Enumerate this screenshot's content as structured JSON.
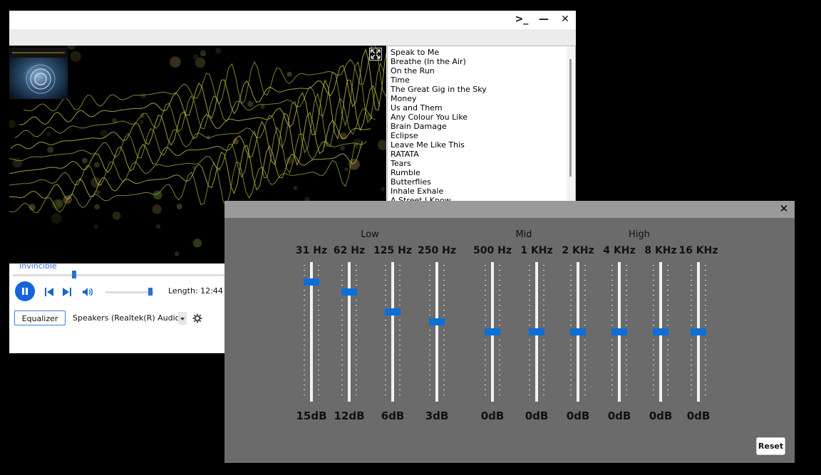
{
  "player": {
    "title_buttons": {
      "terminal": ">_",
      "minimize": "—",
      "close": "✕"
    },
    "now_playing": "Invincible",
    "seek_progress": 0.28,
    "volume_level": 0.88,
    "length_label": "Length: 12:44",
    "equalizer_button": "Equalizer",
    "output_device": "Speakers (Realtek(R) Audio)",
    "accent_color": "#1565d8",
    "playlist": [
      "Speak to Me",
      "Breathe (In the Air)",
      "On the Run",
      "Time",
      "The Great Gig in the Sky",
      "Money",
      "Us and Them",
      "Any Colour You Like",
      "Brain Damage",
      "Eclipse",
      "Leave Me Like This",
      "RATATA",
      "Tears",
      "Rumble",
      "Butterflies",
      "Inhale Exhale",
      "A Street I Know"
    ]
  },
  "equalizer": {
    "close_label": "✕",
    "groups": [
      "Low",
      "Mid",
      "High"
    ],
    "bands": [
      {
        "freq": "31 Hz",
        "gain": "15dB",
        "db": 15
      },
      {
        "freq": "62 Hz",
        "gain": "12dB",
        "db": 12
      },
      {
        "freq": "125 Hz",
        "gain": "6dB",
        "db": 6
      },
      {
        "freq": "250 Hz",
        "gain": "3dB",
        "db": 3
      },
      {
        "freq": "500 Hz",
        "gain": "0dB",
        "db": 0
      },
      {
        "freq": "1 KHz",
        "gain": "0dB",
        "db": 0
      },
      {
        "freq": "2 KHz",
        "gain": "0dB",
        "db": 0
      },
      {
        "freq": "4 KHz",
        "gain": "0dB",
        "db": 0
      },
      {
        "freq": "8 KHz",
        "gain": "0dB",
        "db": 0
      },
      {
        "freq": "16 KHz",
        "gain": "0dB",
        "db": 0
      }
    ],
    "reset_label": "Reset",
    "thumb_color": "#0a6fd8"
  }
}
